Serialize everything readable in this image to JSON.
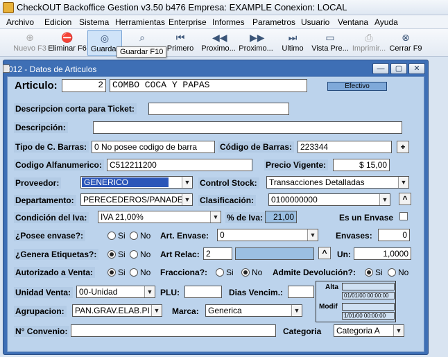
{
  "app": {
    "title": "CheckOUT Backoffice Gestion v3.50 b476 Empresa: EXAMPLE Conexion: LOCAL"
  },
  "menu": [
    "Archivo",
    "Edicion",
    "Sistema",
    "Herramientas",
    "Enterprise",
    "Informes",
    "Parametros",
    "Usuario",
    "Ventana",
    "Ayuda"
  ],
  "toolbar": {
    "buttons": [
      {
        "label": "Nuevo F3",
        "icon": "new-icon"
      },
      {
        "label": "Eliminar F6",
        "icon": "delete-icon"
      },
      {
        "label": "Guardar",
        "icon": "save-icon"
      },
      {
        "label": "",
        "icon": "search-icon"
      },
      {
        "label": "Primero",
        "icon": "first-icon"
      },
      {
        "label": "Proximo...",
        "icon": "previous-icon"
      },
      {
        "label": "Proximo...",
        "icon": "next-icon"
      },
      {
        "label": "Ultimo",
        "icon": "last-icon"
      },
      {
        "label": "Vista Pre...",
        "icon": "preview-icon"
      },
      {
        "label": "Imprimir...",
        "icon": "print-icon"
      },
      {
        "label": "Cerrar F9",
        "icon": "close-icon"
      }
    ],
    "tooltip": "Guardar F10"
  },
  "window": {
    "title": "012 - Datos de Articulos",
    "controls": [
      "minimize",
      "maximize",
      "close"
    ]
  },
  "form": {
    "articulo_label": "Articulo:",
    "articulo_num": "2",
    "articulo_name": "COMBO COCA Y PAPAS",
    "efectivo_button": "Efectivo",
    "desc_corta_label": "Descripcion corta para Ticket:",
    "desc_corta_value": "",
    "descripcion_label": "Descripción:",
    "descripcion_value": "",
    "tipo_barras_label": "Tipo de C. Barras:",
    "tipo_barras_value": "0 No posee codigo de barra",
    "codigo_barras_label": "Código de Barras:",
    "codigo_barras_value": "223344",
    "plus_label": "+",
    "alfa_label": "Codigo Alfanumerico:",
    "alfa_value": "C512211200",
    "precio_label": "Precio Vigente:",
    "precio_value": "$ 15,00",
    "proveedor_label": "Proveedor:",
    "proveedor_value": "GENERICO",
    "control_stock_label": "Control Stock:",
    "control_stock_value": "Transacciones Detalladas",
    "departamento_label": "Departamento:",
    "departamento_value": "PERECEDEROS/PANADE",
    "clasificacion_label": "Clasificación:",
    "clasificacion_value": "0100000000",
    "up_label": "^",
    "iva_label": "Condición del Iva:",
    "iva_value": "IVA 21,00%",
    "pct_iva_label": "% de Iva:",
    "pct_iva_value": "21,00",
    "es_envase_label": "Es un Envase",
    "posee_envase_label": "¿Posee envase?:",
    "art_envase_label": "Art. Envase:",
    "art_envase_value": "0",
    "envases_label": "Envases:",
    "envases_value": "0",
    "genera_etiq_label": "¿Genera Etiquetas?:",
    "art_relac_label": "Art Relac:",
    "art_relac_value": "2",
    "art_relac_desc": "",
    "un_label": "Un:",
    "un_value": "1,0000",
    "autorizado_label": "Autorizado a Venta:",
    "fracciona_label": "Fracciona?:",
    "devolucion_label": "Admite Devolución?:",
    "si": "Si",
    "no": "No",
    "unidad_venta_label": "Unidad Venta:",
    "unidad_venta_value": "00-Unidad",
    "plu_label": "PLU:",
    "plu_value": "",
    "dias_label": "Dias Vencim.:",
    "dias_value": "",
    "alta_label": "Alta",
    "alta_user": "",
    "alta_date": "01/01/00 00:00:00",
    "modif_label": "Modif",
    "modif_user": "",
    "modif_date": "1/01/00 00:00:00",
    "agrupacion_label": "Agrupacion:",
    "agrupacion_value": "PAN.GRAV.ELAB.PI",
    "marca_label": "Marca:",
    "marca_value": "Generica",
    "convenio_label": "N° Convenio:",
    "convenio_value": "",
    "categoria_label": "Categoria",
    "categoria_value": "Categoria A",
    "radios": {
      "posee_envase": "none",
      "genera_etiquetas": "si",
      "autorizado_venta": "si",
      "fracciona": "no",
      "admite_devolucion": "si"
    }
  },
  "colors": {
    "window_frame": "#3e6fb5",
    "form_bg": "#bcd3ec",
    "selection": "#2c56b8"
  }
}
